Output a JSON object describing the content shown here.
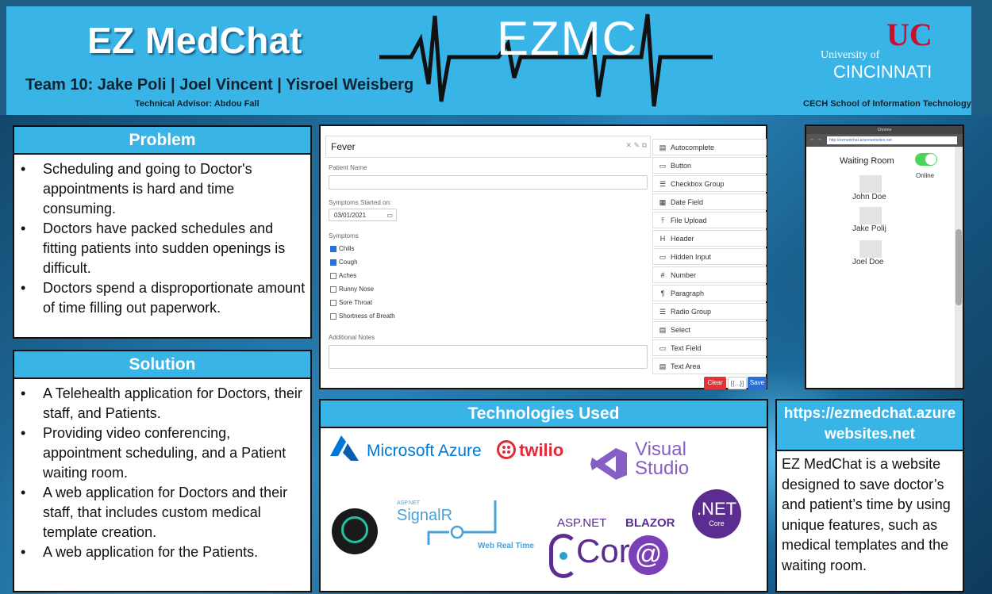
{
  "header": {
    "title": "EZ MedChat",
    "team": "Team 10: Jake Poli | Joel Vincent | Yisroel Weisberg",
    "advisor": "Technical Advisor: Abdou Fall",
    "logo_text": "EZMC",
    "university_of": "University of",
    "university_name": "CINCINNATI",
    "uc_mark": "UC",
    "school": "CECH School of Information Technology"
  },
  "problem": {
    "title": "Problem",
    "items": [
      "Scheduling and going to Doctor's appointments is hard and time consuming.",
      "Doctors have packed schedules and fitting patients into sudden openings is difficult.",
      "Doctors spend a disproportionate amount of time filling out paperwork."
    ]
  },
  "solution": {
    "title": "Solution",
    "items": [
      "A Telehealth application for Doctors, their staff, and Patients.",
      "Providing video conferencing, appointment scheduling, and a Patient waiting room.",
      "A web application for Doctors and their staff, that includes custom medical template creation.",
      "A web application for the Patients."
    ]
  },
  "form_builder": {
    "form_title": "Fever",
    "patient_name_label": "Patient Name",
    "symptoms_started_label": "Symptoms Started on:",
    "date_value": "03/01/2021",
    "symptoms_label": "Symptoms",
    "symptoms": [
      {
        "label": "Chills",
        "checked": true
      },
      {
        "label": "Cough",
        "checked": true
      },
      {
        "label": "Aches",
        "checked": false
      },
      {
        "label": "Runny Nose",
        "checked": false
      },
      {
        "label": "Sore Throat",
        "checked": false
      },
      {
        "label": "Shortness of Breath",
        "checked": false
      }
    ],
    "notes_label": "Additional Notes",
    "controls": [
      "Autocomplete",
      "Button",
      "Checkbox Group",
      "Date Field",
      "File Upload",
      "Header",
      "Hidden Input",
      "Number",
      "Paragraph",
      "Radio Group",
      "Select",
      "Text Field",
      "Text Area"
    ],
    "clear_label": "Clear",
    "json_label": "[{...}]",
    "save_label": "Save"
  },
  "waiting_room": {
    "browser_title": "Chrome",
    "url": "http://ezmedchat.azurewebsites.net",
    "title": "Waiting Room",
    "status": "Online",
    "patients": [
      "John Doe",
      "Jake Polij",
      "Joel Doe"
    ]
  },
  "technologies": {
    "title": "Technologies Used",
    "azure": "Microsoft Azure",
    "twilio": "twilio",
    "visual_studio": "Visual Studio",
    "signalr_small": "ASP.NET",
    "signalr": "SignalR",
    "web_real_time": "Web Real Time",
    "aspnet": "ASP.NET",
    "core": "Core",
    "blazor": "BLAZOR",
    "dotnet": ".NET",
    "dotnet_core": "Core"
  },
  "website": {
    "title": "https://ezmedchat.azurewebsites.net",
    "description": "EZ MedChat is a website designed to save doctor’s and patient’s time by using unique features, such as medical templates and the waiting room."
  },
  "colors": {
    "accent": "#39b4e6",
    "uc_red": "#c8102e",
    "save_blue": "#2a6fd6",
    "clear_red": "#e0343a",
    "toggle_green": "#4cd45a"
  }
}
